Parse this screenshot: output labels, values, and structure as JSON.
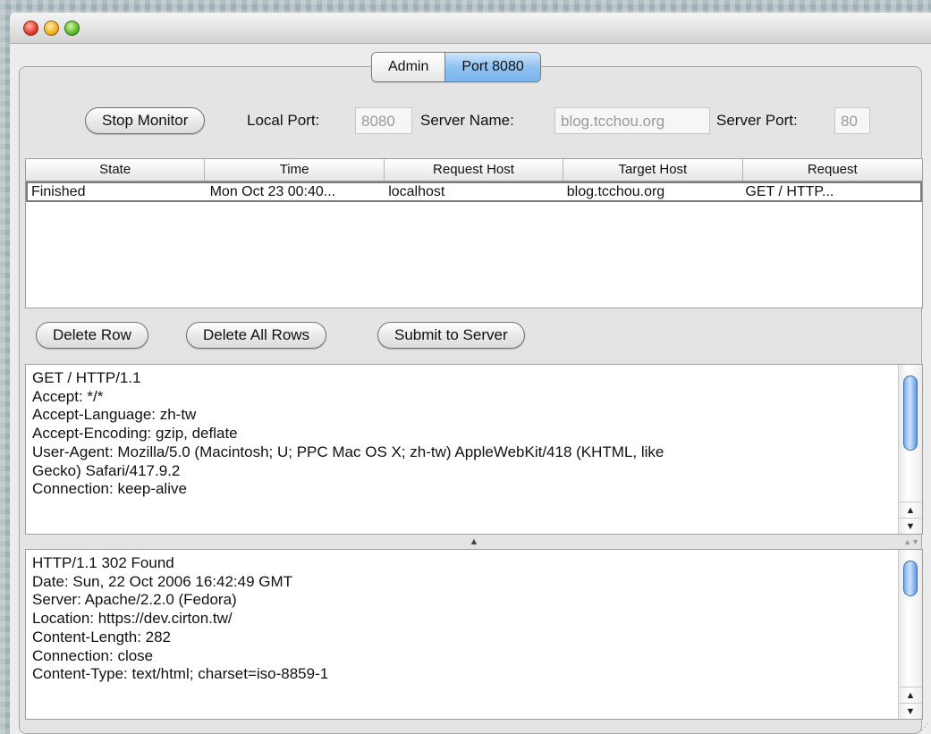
{
  "tabs": [
    {
      "label": "Admin",
      "active": false
    },
    {
      "label": "Port 8080",
      "active": true
    }
  ],
  "toolbar": {
    "stop_button": "Stop Monitor",
    "local_port_label": "Local Port:",
    "local_port_value": "8080",
    "server_name_label": "Server Name:",
    "server_name_value": "blog.tcchou.org",
    "server_port_label": "Server Port:",
    "server_port_value": "80"
  },
  "table": {
    "headers": [
      "State",
      "Time",
      "Request Host",
      "Target Host",
      "Request"
    ],
    "rows": [
      [
        "Finished",
        "Mon Oct 23 00:40...",
        "localhost",
        "blog.tcchou.org",
        "GET / HTTP..."
      ]
    ]
  },
  "actions": {
    "delete_row": "Delete Row",
    "delete_all_rows": "Delete All Rows",
    "submit": "Submit to Server"
  },
  "request_text": [
    "GET / HTTP/1.1",
    "Accept: */*",
    "Accept-Language: zh-tw",
    "Accept-Encoding: gzip, deflate",
    "User-Agent: Mozilla/5.0 (Macintosh; U; PPC Mac OS X; zh-tw) AppleWebKit/418 (KHTML, like",
    "Gecko) Safari/417.9.2",
    "Connection: keep-alive"
  ],
  "response_text": [
    "HTTP/1.1 302 Found",
    "Date: Sun, 22 Oct 2006 16:42:49 GMT",
    "Server: Apache/2.2.0 (Fedora)",
    "Location: https://dev.cirton.tw/",
    "Content-Length: 282",
    "Connection: close",
    "Content-Type: text/html; charset=iso-8859-1"
  ],
  "icons": {
    "close": "close-button-icon",
    "minimize": "minimize-button-icon",
    "zoom": "zoom-button-icon",
    "up": "up-arrow-icon",
    "down": "down-arrow-icon",
    "splitter": "splitter-handle-icon"
  },
  "colors": {
    "tab_active": "#8ec2f3",
    "scroll_thumb": "#6aa5ec",
    "window_bg": "#ececec"
  }
}
